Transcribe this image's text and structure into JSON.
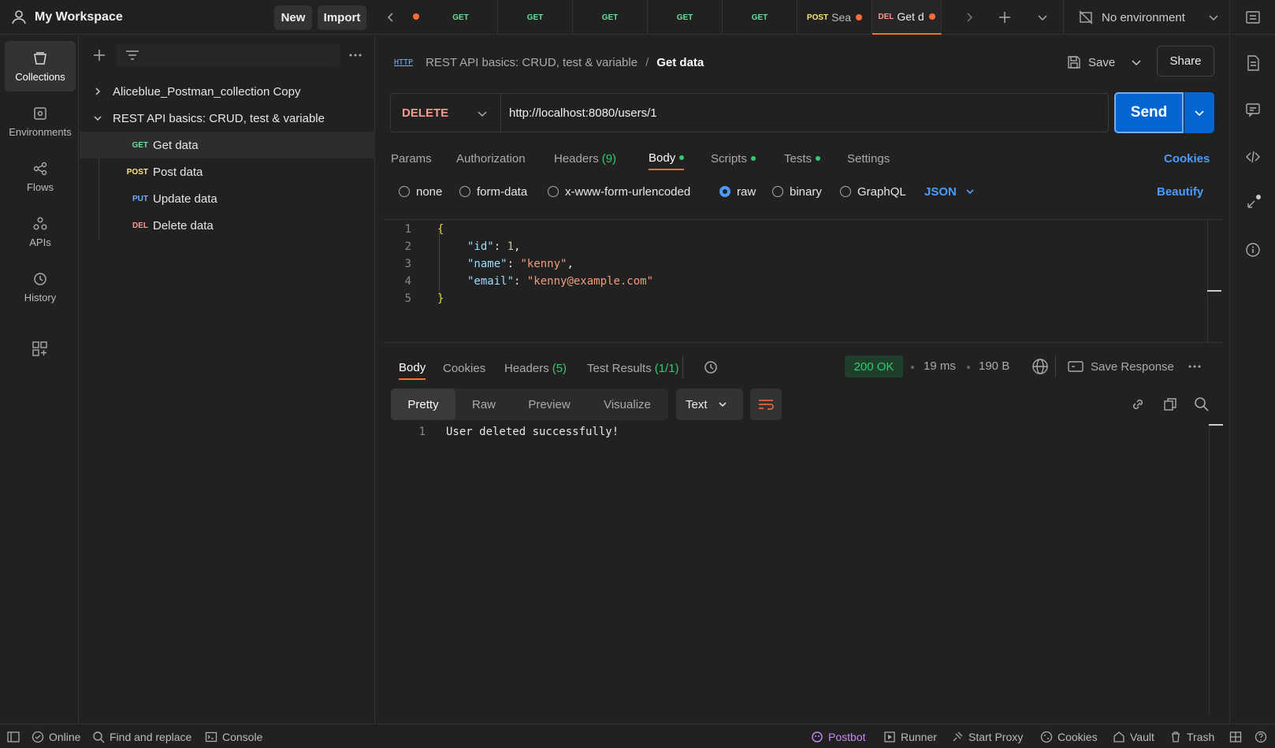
{
  "workspace": {
    "title": "My Workspace",
    "new_label": "New",
    "import_label": "Import"
  },
  "tabs": [
    {
      "method": "GET",
      "name": ""
    },
    {
      "method": "GET",
      "name": ""
    },
    {
      "method": "GET",
      "name": ""
    },
    {
      "method": "GET",
      "name": ""
    },
    {
      "method": "GET",
      "name": ""
    },
    {
      "method": "POST",
      "name": "Sea"
    },
    {
      "method": "DEL",
      "name": "Get d"
    }
  ],
  "environment": {
    "label": "No environment"
  },
  "rail": {
    "collections": "Collections",
    "environments": "Environments",
    "flows": "Flows",
    "apis": "APIs",
    "history": "History"
  },
  "sidebar": {
    "collections": [
      {
        "name": "Aliceblue_Postman_collection Copy"
      },
      {
        "name": "REST API basics: CRUD, test & variable"
      }
    ],
    "requests": [
      {
        "method": "GET",
        "name": "Get data"
      },
      {
        "method": "POST",
        "name": "Post data"
      },
      {
        "method": "PUT",
        "name": "Update data"
      },
      {
        "method": "DEL",
        "name": "Delete data"
      }
    ]
  },
  "request": {
    "breadcrumb_parent": "REST API basics: CRUD, test & variable",
    "breadcrumb_sep": "/",
    "breadcrumb_current": "Get data",
    "http_badge": "HTTP",
    "save_label": "Save",
    "share_label": "Share",
    "method": "DELETE",
    "url": "http://localhost:8080/users/1",
    "send_label": "Send",
    "tabs": {
      "params": "Params",
      "authorization": "Authorization",
      "headers": "Headers",
      "headers_count": "(9)",
      "body": "Body",
      "scripts": "Scripts",
      "tests": "Tests",
      "settings": "Settings"
    },
    "cookies_label": "Cookies",
    "body_modes": {
      "none": "none",
      "form_data": "form-data",
      "urlencoded": "x-www-form-urlencoded",
      "raw": "raw",
      "binary": "binary",
      "graphql": "GraphQL"
    },
    "body_format": "JSON",
    "beautify_label": "Beautify",
    "code_lines": [
      "1",
      "2",
      "3",
      "4",
      "5"
    ],
    "code": {
      "open": "{",
      "id_key": "\"id\"",
      "id_val": "1",
      "name_key": "\"name\"",
      "name_val": "\"kenny\"",
      "email_key": "\"email\"",
      "email_val": "\"kenny@example.com\"",
      "close": "}"
    }
  },
  "response": {
    "tabs": {
      "body": "Body",
      "cookies": "Cookies",
      "headers": "Headers",
      "headers_count": "(5)",
      "test_results": "Test Results",
      "test_count": "(1/1)"
    },
    "status": "200 OK",
    "time": "19 ms",
    "size": "190 B",
    "save_response": "Save Response",
    "views": {
      "pretty": "Pretty",
      "raw": "Raw",
      "preview": "Preview",
      "visualize": "Visualize"
    },
    "format": "Text",
    "line_no": "1",
    "body_text": "User deleted successfully!"
  },
  "statusbar": {
    "online": "Online",
    "find_replace": "Find and replace",
    "console": "Console",
    "postbot": "Postbot",
    "runner": "Runner",
    "start_proxy": "Start Proxy",
    "cookies": "Cookies",
    "vault": "Vault",
    "trash": "Trash"
  },
  "colors": {
    "accent": "#0265d2",
    "link": "#4d9bff",
    "orange": "#ff6c37",
    "green": "#2ecc71",
    "delete": "#f79a8e"
  }
}
